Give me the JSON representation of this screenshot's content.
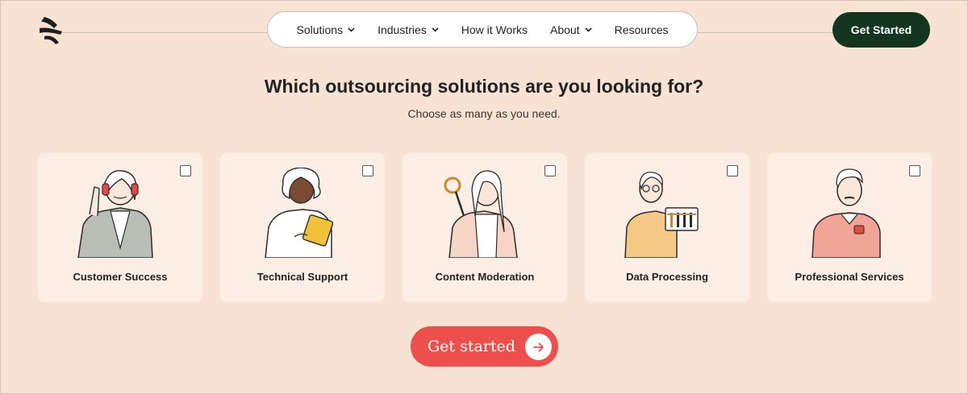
{
  "nav": {
    "items": [
      {
        "label": "Solutions",
        "has_dropdown": true
      },
      {
        "label": "Industries",
        "has_dropdown": true
      },
      {
        "label": "How it Works",
        "has_dropdown": false
      },
      {
        "label": "About",
        "has_dropdown": true
      },
      {
        "label": "Resources",
        "has_dropdown": false
      }
    ],
    "cta_label": "Get Started"
  },
  "main": {
    "heading": "Which outsourcing solutions are you looking for?",
    "subheading": "Choose as many as you need.",
    "options": [
      {
        "label": "Customer Success",
        "icon": "headset-agent-illustration",
        "checked": false
      },
      {
        "label": "Technical Support",
        "icon": "tablet-support-illustration",
        "checked": false
      },
      {
        "label": "Content Moderation",
        "icon": "magnifier-moderator-illustration",
        "checked": false
      },
      {
        "label": "Data Processing",
        "icon": "data-chart-illustration",
        "checked": false
      },
      {
        "label": "Professional Services",
        "icon": "professional-person-illustration",
        "checked": false
      }
    ],
    "submit_label": "Get started"
  },
  "colors": {
    "background": "#f8e2d3",
    "card": "#fdeee5",
    "nav_cta": "#14351f",
    "primary_cta": "#ec4f4c"
  }
}
